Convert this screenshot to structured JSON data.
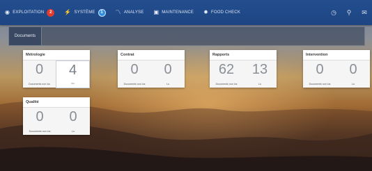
{
  "navbar": {
    "items": [
      {
        "label": "EXPLOITATION",
        "icon": "eye-icon",
        "badge": "2",
        "badge_color": "#e23a2f"
      },
      {
        "label": "SYSTÈME",
        "icon": "bolt-icon",
        "badge": "1",
        "badge_color": "#2f8fe0"
      },
      {
        "label": "ANALYSE",
        "icon": "line-chart-icon"
      },
      {
        "label": "MAINTENANCE",
        "icon": "monitor-icon"
      },
      {
        "label": "FOOD CHECK",
        "icon": "gear-icon"
      }
    ],
    "right_icons": [
      "clock-icon",
      "user-icon",
      "mail-icon"
    ]
  },
  "toolbar": {
    "tab_label": "Documents"
  },
  "cards": [
    {
      "title": "Métrologie",
      "value_left": "0",
      "label_left": "Documents non lus",
      "value_right": "4",
      "label_right": "Lu"
    },
    {
      "title": "Contrat",
      "value_left": "0",
      "label_left": "Documents non lus",
      "value_right": "0",
      "label_right": "Lu"
    },
    {
      "title": "Rapports",
      "value_left": "62",
      "label_left": "Documents non lus",
      "value_right": "13",
      "label_right": "Lu"
    },
    {
      "title": "Intervention",
      "value_left": "0",
      "label_left": "Documents non lus",
      "value_right": "0",
      "label_right": "Lu"
    },
    {
      "title": "Qualité",
      "value_left": "0",
      "label_left": "Documents non lus",
      "value_right": "0",
      "label_right": "Lu"
    }
  ],
  "colors": {
    "navbar": "#1d4583",
    "accent_red": "#e23a2f",
    "accent_blue": "#2f8fe0"
  }
}
